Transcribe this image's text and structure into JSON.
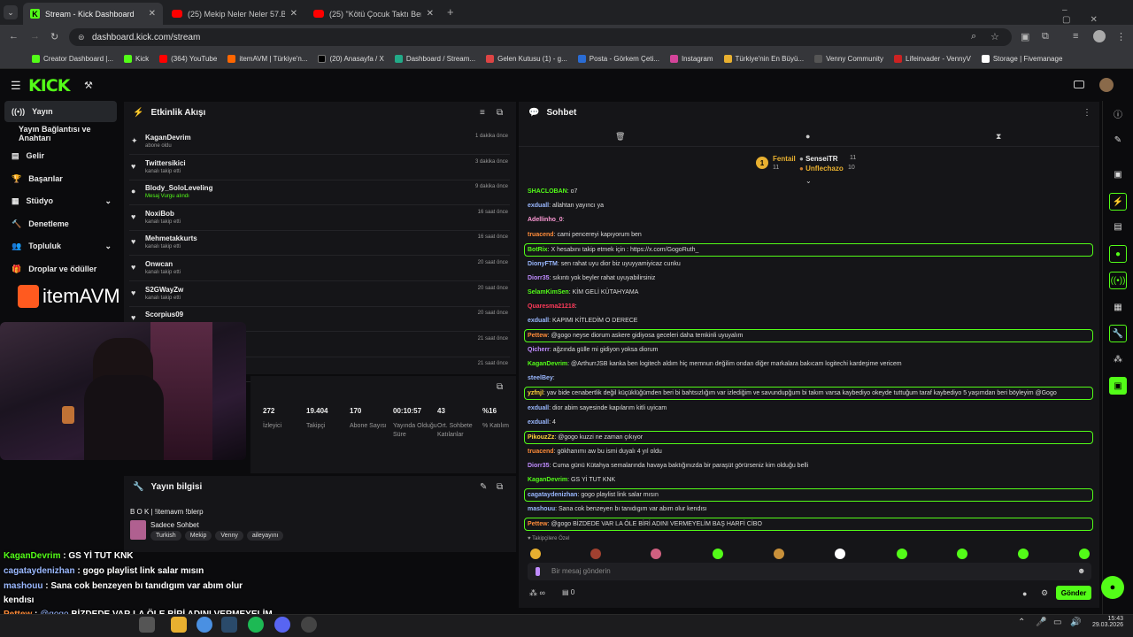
{
  "browser": {
    "tabs": [
      {
        "title": "Stream - Kick Dashboard",
        "type": "kick"
      },
      {
        "title": "(25) Mekip Neler Neler 57.Bölü",
        "type": "yt"
      },
      {
        "title": "(25) \"Kötü Çocuk Taktı Beresini",
        "type": "yt"
      }
    ],
    "url": "dashboard.kick.com/stream",
    "bookmarks": [
      "Creator Dashboard |...",
      "Kick",
      "(364) YouTube",
      "itemAVM | Türkiye'n...",
      "(20) Anasayfa / X",
      "Dashboard / Stream...",
      "Gelen Kutusu (1) - g...",
      "Posta - Görkem Çeti...",
      "Instagram",
      "Türkiye'nin En Büyü...",
      "Venny Community",
      "Lifeinvader - VennyV",
      "Storage | Fivemanage"
    ]
  },
  "brand": {
    "logo": "KICK",
    "accent": "#53fc18"
  },
  "sidebar": {
    "items": [
      {
        "label": "Yayın",
        "icon": "broadcast-icon"
      },
      {
        "label": "Yayın Bağlantısı ve Anahtarı",
        "icon": ""
      },
      {
        "label": "Gelir",
        "icon": "wallet-icon"
      },
      {
        "label": "Başarılar",
        "icon": "trophy-icon"
      },
      {
        "label": "Stüdyo",
        "icon": "studio-icon"
      },
      {
        "label": "Denetleme",
        "icon": "hammer-icon"
      },
      {
        "label": "Topluluk",
        "icon": "community-icon"
      },
      {
        "label": "Droplar ve ödüller",
        "icon": "gift-icon"
      }
    ],
    "sponsor": "itemAVM"
  },
  "activity": {
    "title": "Etkinlik Akışı",
    "events": [
      {
        "name": "KaganDevrim",
        "sub": "abone oldu",
        "time": "1 dakika önce"
      },
      {
        "name": "Twittersikici",
        "sub": "kanalı takip etti",
        "time": "3 dakika önce"
      },
      {
        "name": "Blody_SoloLeveling",
        "sub": "Mesaj Vurgu alındı",
        "time": "9 dakika önce"
      },
      {
        "name": "NoxiBob",
        "sub": "kanalı takip etti",
        "time": "16 saat önce"
      },
      {
        "name": "Mehmetakkurts",
        "sub": "kanalı takip etti",
        "time": "16 saat önce"
      },
      {
        "name": "Onwcan",
        "sub": "kanalı takip etti",
        "time": "20 saat önce"
      },
      {
        "name": "S2GWayZw",
        "sub": "kanalı takip etti",
        "time": "20 saat önce"
      },
      {
        "name": "Scorpius09",
        "sub": "",
        "time": "20 saat önce"
      },
      {
        "name": "",
        "sub": "",
        "time": "21 saat önce"
      },
      {
        "name": "",
        "sub": "",
        "time": "21 saat önce"
      }
    ]
  },
  "stats": [
    {
      "value": "272",
      "label": "İzleyici"
    },
    {
      "value": "19.404",
      "label": "Takipçi"
    },
    {
      "value": "170",
      "label": "Abone Sayısı"
    },
    {
      "value": "00:10:57",
      "label": "Yayında Olduğu Süre"
    },
    {
      "value": "43",
      "label": "Ort. Sohbete Katılanlar"
    },
    {
      "value": "%16",
      "label": "% Katılım"
    }
  ],
  "streaminfo": {
    "title": "Yayın bilgisi",
    "stream_title": "B O K | !itemavm !blerp",
    "category": "Sadece Sohbet",
    "tags": [
      "Turkish",
      "Mekip",
      "Venny",
      "aileyayını"
    ]
  },
  "chat": {
    "title": "Sohbet",
    "top": {
      "first": "Fentail",
      "first_count": "11",
      "second": "SenseiTR",
      "second_count": "11",
      "third": "Unflechazo",
      "third_count": "10"
    },
    "messages": [
      {
        "user": "SHACLOBAN",
        "text": "o7",
        "color": "#53fc18",
        "hl": false
      },
      {
        "user": "exduall",
        "text": "allahtan yayıncı ya",
        "color": "#9ab8ff",
        "hl": false
      },
      {
        "user": "Adellinho_0",
        "text": "",
        "color": "#ff9ad6",
        "hl": false
      },
      {
        "user": "truacend",
        "text": "cami pencereyi kapıyorum ben",
        "color": "#ff8c3a",
        "hl": false
      },
      {
        "user": "BotRix",
        "text": "X hesabını takip etmek için : https://x.com/GogoRuth_",
        "color": "#53fc18",
        "hl": true
      },
      {
        "user": "DionyFTM",
        "text": "sen rahat uyu dior biz uyuyyamiyicaz cunku",
        "color": "#9ab8ff",
        "hl": false
      },
      {
        "user": "Diorr35",
        "text": "sıkıntı yok beyler rahat uyuyabilirsiniz",
        "color": "#c08cff",
        "hl": false
      },
      {
        "user": "SelamKimSen",
        "text": "KİM GELİ KÜTAHYAMA",
        "color": "#53fc18",
        "hl": false
      },
      {
        "user": "Quaresma21218",
        "text": "",
        "color": "#ff3a5a",
        "hl": false
      },
      {
        "user": "exduall",
        "text": "KAPIMI KİTLEDİM O DERECE",
        "color": "#9ab8ff",
        "hl": false
      },
      {
        "user": "Pettew",
        "text": "@gogo neyse diorum askere gidiyosa geceleri daha temkinli uyuyalım",
        "color": "#ff8c3a",
        "hl": true
      },
      {
        "user": "Qicherr",
        "text": "ağzında gülle mi gidiyon yoksa diorum",
        "color": "#c08cff",
        "hl": false
      },
      {
        "user": "KaganDevrim",
        "text": "@ArthurrJSB kanka ben logitech aldım hiç memnun değilim ondan diğer markalara bakıcam logitechi kardeşime vericem",
        "color": "#53fc18",
        "hl": false
      },
      {
        "user": "steelBey",
        "text": "",
        "color": "#9ab8ff",
        "hl": false
      },
      {
        "user": "yzfnjl",
        "text": "yav bide cenabertlik değil küçüklüğümden beri bi bahtsızlığım var izlediğim ve savundupğum bi takım varsa kaybediyo okeyde tuttuğum taraf kaybediyo 5 yaşımdan beri böyleyim @Gogo",
        "color": "#ffd23a",
        "hl": true
      },
      {
        "user": "exduall",
        "text": "dior abim sayesinde kapılarım kitli uyicam",
        "color": "#9ab8ff",
        "hl": false
      },
      {
        "user": "exduall",
        "text": "4",
        "color": "#9ab8ff",
        "hl": false
      },
      {
        "user": "PikouzZz",
        "text": "@gogo kuzzi ne zaman çıkıyor",
        "color": "#ffd23a",
        "hl": true
      },
      {
        "user": "truacend",
        "text": "gökhanımı aw bu ismi duyalı 4 yıl oldu",
        "color": "#ff8c3a",
        "hl": false
      },
      {
        "user": "Diorr35",
        "text": "Cuma günü Kütahya semalarında havaya baktığınızda bir paraşüt görürseniz kim olduğu belli",
        "color": "#c08cff",
        "hl": false
      },
      {
        "user": "KaganDevrim",
        "text": "GS Yİ TUT KNK",
        "color": "#53fc18",
        "hl": false
      },
      {
        "user": "cagataydenizhan",
        "text": "gogo playlist link salar mısın",
        "color": "#9ab8ff",
        "hl": true
      },
      {
        "user": "mashouu",
        "text": "Sana cok benzeyen bı tanıdıgım var abım olur kendısı",
        "color": "#9ab8ff",
        "hl": false
      },
      {
        "user": "Pettew",
        "text": "@gogo BİZDEDE VAR LA ÖLE BİRİ ADINI VERMEYELİM BAŞ HARFİ CİBO",
        "color": "#ff8c3a",
        "hl": true
      }
    ],
    "followers_only": "Takipçilere Özel",
    "input_placeholder": "Bir mesaj gönderin",
    "send_label": "Gönder",
    "zero_label": "0"
  },
  "overlay_chat": [
    {
      "user": "KaganDevrim",
      "text": "GS Yİ TUT KNK",
      "color": "#53fc18"
    },
    {
      "user": "cagataydenizhan",
      "text": "gogo playlist link salar mısın",
      "color": "#9ab8ff"
    },
    {
      "user": "mashouu",
      "text": "Sana cok benzeyen bı tanıdıgım var abım olur",
      "color": "#9ab8ff"
    },
    {
      "user": "",
      "text": "kendısı",
      "color": "#fff"
    },
    {
      "user": "Pettew",
      "text": "BİZDEDE VAR LA ÖLE BİRİ ADINI VERMEYELİM",
      "color": "#ff8c3a",
      "mention": "@gogo"
    },
    {
      "user": "",
      "text": "BAŞ HARFİ CİBO",
      "color": "#fff"
    }
  ],
  "taskbar": {
    "time": "15:43",
    "date": "29.03.2026"
  }
}
